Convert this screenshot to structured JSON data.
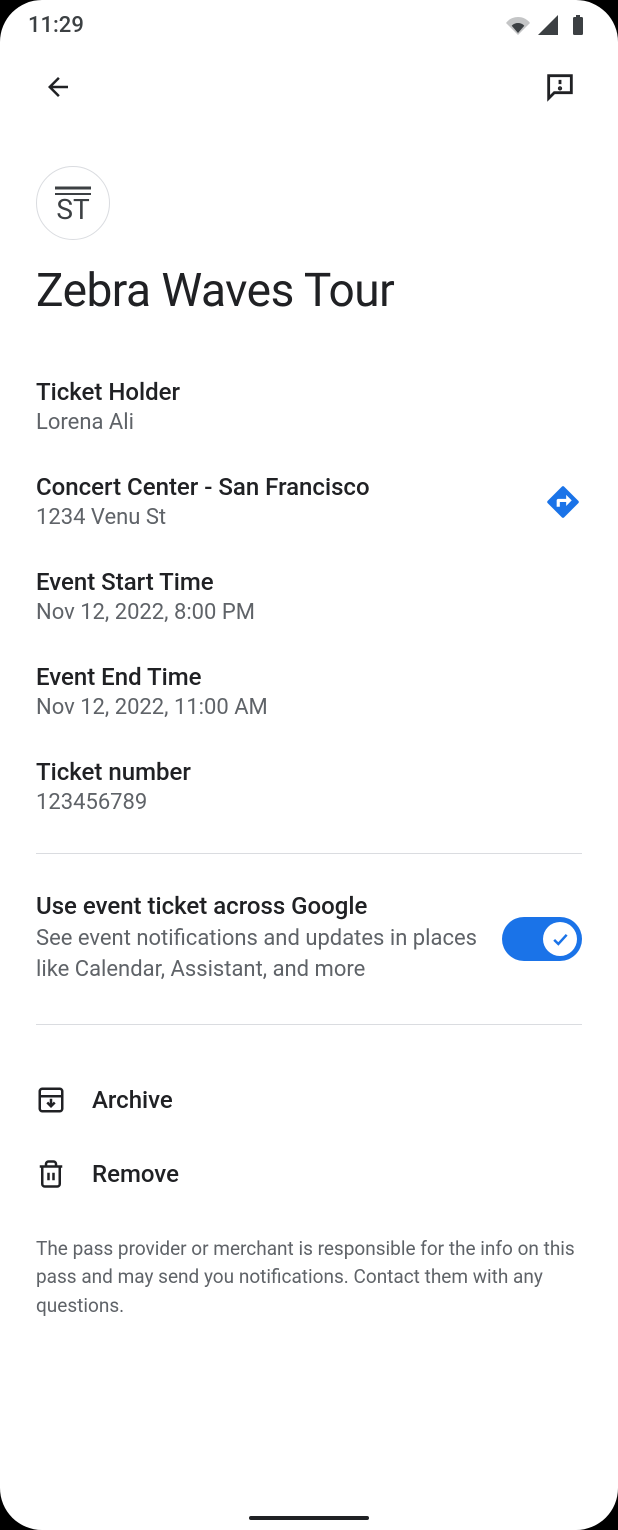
{
  "status": {
    "time": "11:29"
  },
  "provider": {
    "logo_text": "ST"
  },
  "event": {
    "title": "Zebra Waves Tour"
  },
  "details": {
    "ticket_holder": {
      "label": "Ticket Holder",
      "value": "Lorena Ali"
    },
    "venue": {
      "label": "Concert Center - San Francisco",
      "value": "1234 Venu St"
    },
    "start_time": {
      "label": "Event Start Time",
      "value": "Nov 12, 2022, 8:00 PM"
    },
    "end_time": {
      "label": "Event End Time",
      "value": "Nov 12, 2022, 11:00 AM"
    },
    "ticket_number": {
      "label": "Ticket number",
      "value": "123456789"
    }
  },
  "toggle": {
    "label": "Use event ticket across Google",
    "description": "See event notifications and updates in places like Calendar, Assistant, and more"
  },
  "actions": {
    "archive": "Archive",
    "remove": "Remove"
  },
  "footer": {
    "text": "The pass provider or merchant is responsible for the info on this pass and may send you notifications. Contact them with any questions."
  }
}
